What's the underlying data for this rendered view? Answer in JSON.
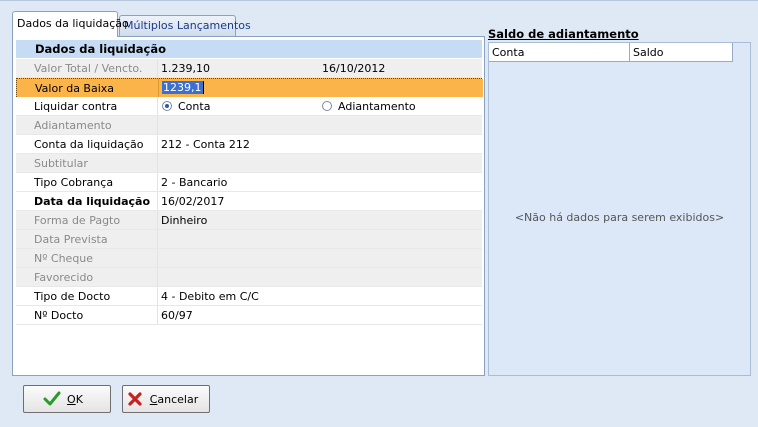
{
  "tabs": [
    {
      "label": "Dados da liquidação",
      "active": true
    },
    {
      "label": "Múltiplos Lançamentos",
      "active": false
    }
  ],
  "form": {
    "group_title": "Dados da liquidação",
    "rows": {
      "valor_total": {
        "label": "Valor Total / Vencto.",
        "value": "1.239,10",
        "date": "16/10/2012"
      },
      "valor_baixa": {
        "label": "Valor da Baixa",
        "value": "1239,1"
      },
      "liquidar_contra": {
        "label": "Liquidar contra",
        "option1": "Conta",
        "option2": "Adiantamento",
        "selected": "Conta"
      },
      "adiantamento": {
        "label": "Adiantamento",
        "value": ""
      },
      "conta_liquidacao": {
        "label": "Conta da liquidação",
        "value": "212 - Conta 212"
      },
      "subtitular": {
        "label": "Subtitular",
        "value": ""
      },
      "tipo_cobranca": {
        "label": "Tipo Cobrança",
        "value": "2 - Bancario"
      },
      "data_liquidacao": {
        "label": "Data da liquidação",
        "value": "16/02/2017"
      },
      "forma_pagto": {
        "label": "Forma de Pagto",
        "value": "Dinheiro"
      },
      "data_prevista": {
        "label": "Data Prevista",
        "value": ""
      },
      "num_cheque": {
        "label": "Nº Cheque",
        "value": ""
      },
      "favorecido": {
        "label": "Favorecido",
        "value": ""
      },
      "tipo_docto": {
        "label": "Tipo de Docto",
        "value": "4 - Debito em C/C"
      },
      "num_docto": {
        "label": "Nº Docto",
        "value": "60/97"
      }
    }
  },
  "saldo": {
    "title": "Saldo de adiantamento",
    "columns": [
      "Conta",
      "Saldo"
    ],
    "empty_message": "<Não há dados para serem exibidos>"
  },
  "buttons": {
    "ok": {
      "label_prefix": "",
      "accel": "O",
      "label_rest": "K"
    },
    "cancel": {
      "accel": "C",
      "label_rest": "ancelar"
    }
  },
  "colors": {
    "highlight": "#fbb44a",
    "group_header": "#c6dcf5",
    "grid_bg": "#dce8f7"
  },
  "icons": {
    "ok": "checkmark-icon",
    "cancel": "x-icon"
  }
}
